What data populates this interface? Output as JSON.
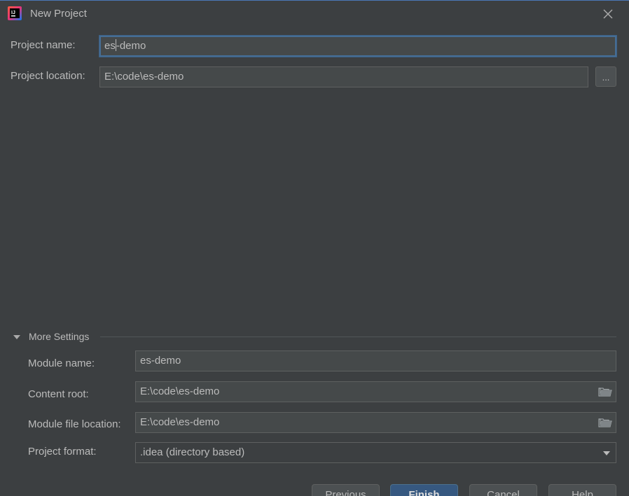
{
  "window": {
    "title": "New Project",
    "app_icon": "intellij-idea-icon",
    "close_icon": "close-icon"
  },
  "form": {
    "project_name": {
      "label": "Project name:",
      "value_before_caret": "es",
      "value_after_caret": "-demo"
    },
    "project_location": {
      "label": "Project location:",
      "value": "E:\\code\\es-demo",
      "browse_label": "..."
    }
  },
  "more_settings": {
    "label": "More Settings",
    "expanded": true,
    "module_name": {
      "label": "Module name:",
      "value": "es-demo"
    },
    "content_root": {
      "label": "Content root:",
      "value": "E:\\code\\es-demo",
      "icon": "folder-icon"
    },
    "module_file_location": {
      "label": "Module file location:",
      "value": "E:\\code\\es-demo",
      "icon": "folder-icon"
    },
    "project_format": {
      "label": "Project format:",
      "selected": ".idea (directory based)"
    }
  },
  "buttons": {
    "previous": "Previous",
    "finish": "Finish",
    "cancel": "Cancel",
    "help": "Help"
  },
  "colors": {
    "background": "#3c3f41",
    "field_background": "#45494a",
    "focus_border": "#466d94",
    "primary_button": "#365880",
    "text": "#bbbbbb"
  }
}
